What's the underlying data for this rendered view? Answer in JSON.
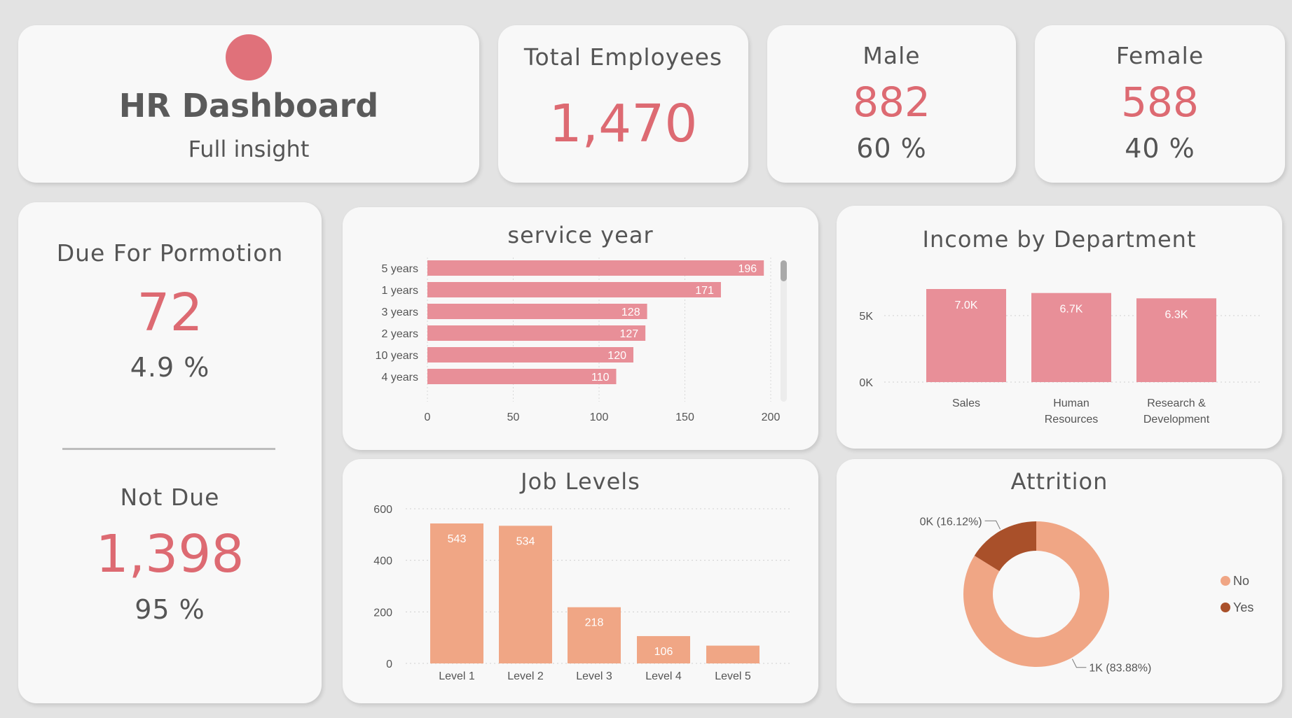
{
  "header": {
    "title": "HR Dashboard",
    "subtitle": "Full insight",
    "logo_color": "#e0717a"
  },
  "kpis": {
    "total": {
      "label": "Total Employees",
      "value": "1,470"
    },
    "male": {
      "label": "Male",
      "value": "882",
      "pct": "60 %"
    },
    "female": {
      "label": "Female",
      "value": "588",
      "pct": "40 %"
    }
  },
  "promotion": {
    "due_label": "Due For Pormotion",
    "due_value": "72",
    "due_pct": "4.9 %",
    "notdue_label": "Not Due",
    "notdue_value": "1,398",
    "notdue_pct": "95 %"
  },
  "colors": {
    "accent": "#dd6a72",
    "bar_pink": "#e88f98",
    "bar_salmon": "#f0a685",
    "attrition_no": "#f0a685",
    "attrition_yes": "#a9502a"
  },
  "chart_data": [
    {
      "id": "service_year",
      "type": "bar",
      "orientation": "horizontal",
      "title": "service year",
      "categories": [
        "5 years",
        "1 years",
        "3 years",
        "2 years",
        "10 years",
        "4 years"
      ],
      "values": [
        196,
        171,
        128,
        127,
        120,
        110
      ],
      "data_labels": [
        "196",
        "171",
        "128",
        "127",
        "120",
        "110"
      ],
      "xlim": [
        0,
        200
      ],
      "xticks": [
        "0",
        "50",
        "100",
        "150",
        "200"
      ],
      "grid": true
    },
    {
      "id": "income_by_department",
      "type": "bar",
      "title": "Income by Department",
      "categories": [
        [
          "Sales"
        ],
        [
          "Human",
          "Resources"
        ],
        [
          "Research &",
          "Development"
        ]
      ],
      "values": [
        7.0,
        6.7,
        6.3
      ],
      "data_labels": [
        "7.0K",
        "6.7K",
        "6.3K"
      ],
      "ylim": [
        0,
        7.0
      ],
      "yticks": [
        "0K",
        "5K"
      ],
      "ytick_values": [
        0,
        5
      ],
      "grid": true
    },
    {
      "id": "job_levels",
      "type": "bar",
      "title": "Job Levels",
      "categories": [
        "Level 1",
        "Level 2",
        "Level 3",
        "Level 4",
        "Level 5"
      ],
      "values": [
        543,
        534,
        218,
        106,
        69
      ],
      "data_labels": [
        "543",
        "534",
        "218",
        "106",
        ""
      ],
      "ylim": [
        0,
        600
      ],
      "yticks": [
        "0",
        "200",
        "400",
        "600"
      ],
      "ytick_values": [
        0,
        200,
        400,
        600
      ],
      "grid": true
    },
    {
      "id": "attrition",
      "type": "pie",
      "donut": true,
      "title": "Attrition",
      "slices": [
        {
          "name": "No",
          "value": 83.88,
          "label": "1K (83.88%)"
        },
        {
          "name": "Yes",
          "value": 16.12,
          "label": "0K (16.12%)"
        }
      ],
      "legend": [
        "No",
        "Yes"
      ],
      "legend_position": "right"
    }
  ]
}
